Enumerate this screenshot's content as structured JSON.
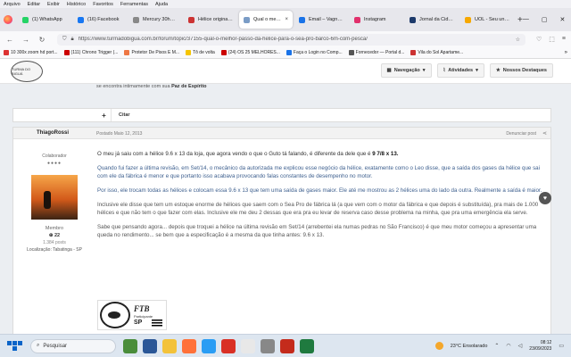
{
  "browser": {
    "menu": [
      "Arquivo",
      "Editar",
      "Exibir",
      "Histórico",
      "Favoritos",
      "Ferramentas",
      "Ajuda"
    ],
    "tabs": [
      {
        "label": "(1) WhatsApp",
        "color": "#25d366",
        "active": false
      },
      {
        "label": "(16) Facebook",
        "color": "#1877f2",
        "active": false
      },
      {
        "label": "Mercury 30hp 2T",
        "color": "#888888",
        "active": false
      },
      {
        "label": "Hélice original | H",
        "color": "#cc3333",
        "active": false
      },
      {
        "label": "Qual o melhor",
        "color": "#7a9cc6",
        "active": true
      },
      {
        "label": "Email – Vagner M",
        "color": "#1a73e8",
        "active": false
      },
      {
        "label": "Instagram",
        "color": "#e1306c",
        "active": false
      },
      {
        "label": "Jornal da Cidade",
        "color": "#1d3a6b",
        "active": false
      },
      {
        "label": "UOL - Seu univer",
        "color": "#f6a800",
        "active": false
      }
    ],
    "url": "https://www.turmadobigua.com.br/forum/topic/37155-qual-o-melhor-passo-da-helice-para-o-sea-pro-barco-6m-com-pesca/",
    "bookmarks": [
      {
        "label": "10 300x zoom hd port...",
        "color": "#d33"
      },
      {
        "label": "(111) Chrono Trigger (...",
        "color": "#c00"
      },
      {
        "label": "Protetor De Pisos E M...",
        "color": "#e74"
      },
      {
        "label": "Tô de volta",
        "color": "#f5c400"
      },
      {
        "label": "(24) OS 25 MELHORES...",
        "color": "#c00"
      },
      {
        "label": "Faça o Login no Comp...",
        "color": "#1a73e8"
      },
      {
        "label": "Fornecedor — Portal d...",
        "color": "#555"
      },
      {
        "label": "Vila do Sol Apartame...",
        "color": "#c33"
      }
    ]
  },
  "site": {
    "logo_text": "TURMA DO BIGUÁ",
    "nav": [
      {
        "label": "Navegação",
        "icon": "chevron-down-icon"
      },
      {
        "label": "Atividades",
        "icon": "chevron-down-icon"
      },
      {
        "label": "Nossos Destaques",
        "icon": "star-icon"
      }
    ]
  },
  "prev_post": {
    "tail_text": "se encontra intimamente com sua",
    "tail_bold": "Paz de Espírito"
  },
  "action": {
    "plus": "+",
    "quote": "Citar"
  },
  "post": {
    "author": "ThiagoRossi",
    "date": "Postado Maio 12, 2013",
    "report": "Denunciar post",
    "role": "Colaborador",
    "pips": "●●●●",
    "member": "Membro",
    "reputation": "22",
    "posts": "1.384 posts",
    "location": "Localização: Tabatinga - SP",
    "p1_a": "O meu já saiu com a hélice 9.6 x 13 da loja, que agora vendo o que o Guto tá falando, é diferente da dele que é",
    "p1_b": "9 7/8 x 13.",
    "p2": "Quando fui fazer a última revisão, em Set/14, o mecânico da autorizada me explicou esse negócio da hélice, exatamente como o Leo disse, que a saída dos gases da hélice que sai com ele da fábrica é menor e que portanto isso acabava provocando falas constantes de desempenho no motor.",
    "p3": "Por isso, ele trocam todas as hélices e colocam essa 9.6 x 13 que tem uma saída de gases maior. Ele até me mostrou as 2 hélices uma do lado da outra. Realmente a saída é maior.",
    "p4": "Inclusive ele disse que tem um estoque enorme de hélices que saem com o Sea Pro de fábrica lá (a que vem com o motor da fábrica e que depois é substituída), pra mais de 1.000 hélices e que não tem o que fazer com elas. Inclusive ele me deu 2 dessas que era pra eu levar de reserva caso desse problema na minha, que pra uma emergência ela serve.",
    "p5": "Sabe que pensando agora... depois que troquei a hélice na última revisão em Set/14 (arrebentei ela numas pedras no São Francisco) é que meu motor começou a apresentar uma queda no rendimento... se bem que a especificação é a mesma da que tinha antes: 9.6 x 13."
  },
  "signature": {
    "title": "FTB",
    "subtitle": "Participante",
    "state": "SP"
  },
  "taskbar": {
    "search": "Pesquisar",
    "weather": "23°C  Ensolarado",
    "time": "08:12",
    "date": "23/09/2023"
  }
}
